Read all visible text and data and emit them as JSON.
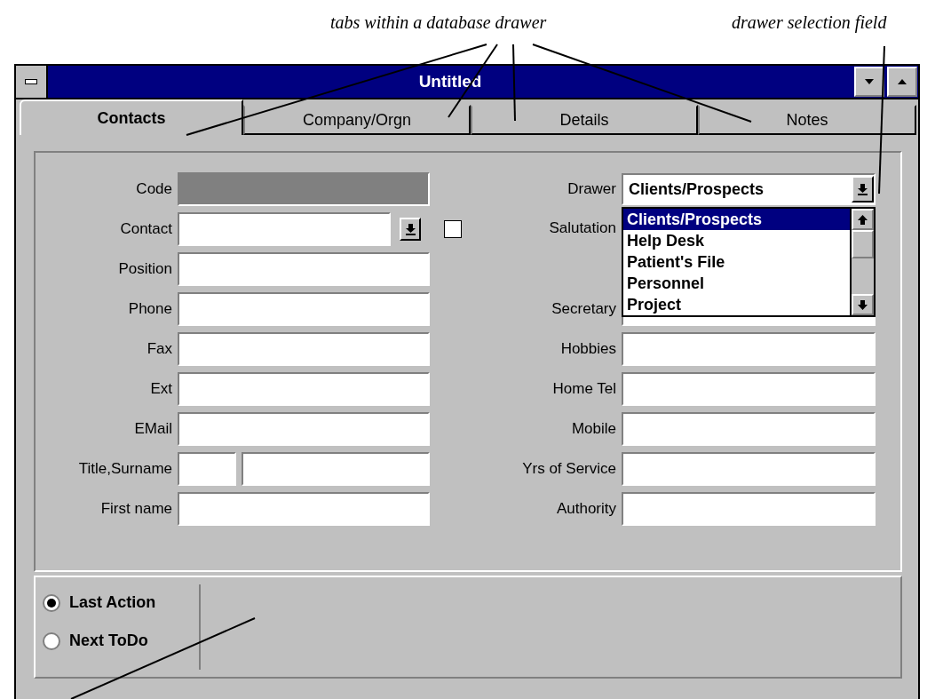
{
  "annotations": [
    {
      "text": "tabs within a database drawer"
    },
    {
      "text": "drawer selection field"
    }
  ],
  "window": {
    "title": "Untitled"
  },
  "tabs": [
    {
      "label": "Contacts",
      "selected": true
    },
    {
      "label": "Company/Orgn",
      "selected": false
    },
    {
      "label": "Details",
      "selected": false
    },
    {
      "label": "Notes",
      "selected": false
    }
  ],
  "left_fields": [
    {
      "label": "Code",
      "kind": "readonly"
    },
    {
      "label": "Contact",
      "kind": "combo",
      "checked": false
    },
    {
      "label": "Position",
      "kind": "text"
    },
    {
      "label": "Phone",
      "kind": "text"
    },
    {
      "label": "Fax",
      "kind": "text"
    },
    {
      "label": "Ext",
      "kind": "text"
    },
    {
      "label": "EMail",
      "kind": "text"
    },
    {
      "label": "Title,Surname",
      "kind": "split"
    },
    {
      "label": "First name",
      "kind": "text"
    }
  ],
  "drawer": {
    "label": "Drawer",
    "value": "Clients/Prospects",
    "expanded": true,
    "options": [
      {
        "label": "Clients/Prospects",
        "selected": true
      },
      {
        "label": "Help Desk",
        "selected": false
      },
      {
        "label": "Patient's File",
        "selected": false
      },
      {
        "label": "Personnel",
        "selected": false
      },
      {
        "label": "Project",
        "selected": false
      }
    ]
  },
  "right_fields": [
    {
      "label": "Salutation",
      "kind": "covered"
    },
    {
      "label": "Secretary",
      "kind": "text"
    },
    {
      "label": "Hobbies",
      "kind": "text"
    },
    {
      "label": "Home Tel",
      "kind": "text"
    },
    {
      "label": "Mobile",
      "kind": "text"
    },
    {
      "label": "Yrs of Service",
      "kind": "text"
    },
    {
      "label": "Authority",
      "kind": "text"
    }
  ],
  "view": [
    {
      "label": "Last Action",
      "selected": true
    },
    {
      "label": "Next ToDo",
      "selected": false
    }
  ]
}
